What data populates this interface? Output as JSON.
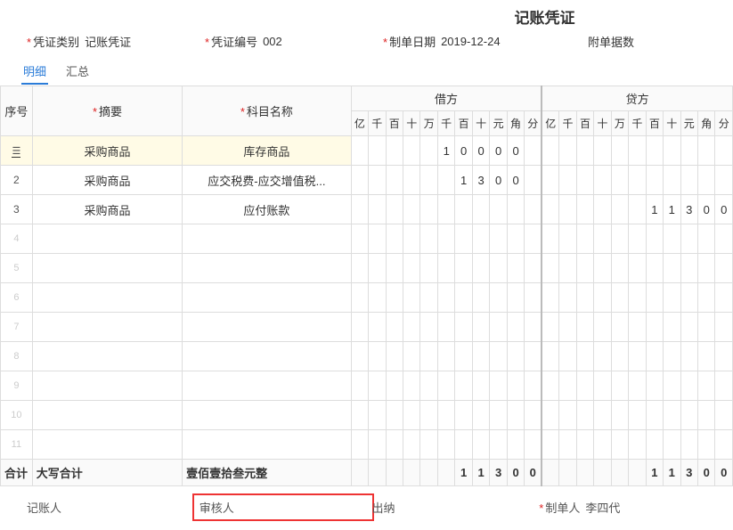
{
  "title": "记账凭证",
  "header": {
    "type_label": "凭证类别",
    "type_value": "记账凭证",
    "no_label": "凭证编号",
    "no_value": "002",
    "date_label": "制单日期",
    "date_value": "2019-12-24",
    "attach_label": "附单据数",
    "attach_value": ""
  },
  "tabs": {
    "detail": "明细",
    "summary": "汇总"
  },
  "columns": {
    "seq": "序号",
    "summary": "摘要",
    "account": "科目名称",
    "debit": "借方",
    "credit": "贷方",
    "digits": [
      "亿",
      "千",
      "百",
      "十",
      "万",
      "千",
      "百",
      "十",
      "元",
      "角",
      "分"
    ]
  },
  "rows": [
    {
      "seq": "",
      "summary": "采购商品",
      "account": "库存商品",
      "debit": [
        "",
        "",
        "",
        "",
        "",
        "1",
        "0",
        "0",
        "0",
        "0",
        ""
      ],
      "credit": [
        "",
        "",
        "",
        "",
        "",
        "",
        "",
        "",
        "",
        "",
        ""
      ]
    },
    {
      "seq": "2",
      "summary": "采购商品",
      "account": "应交税费-应交增值税...",
      "debit": [
        "",
        "",
        "",
        "",
        "",
        "",
        "1",
        "3",
        "0",
        "0",
        ""
      ],
      "credit": [
        "",
        "",
        "",
        "",
        "",
        "",
        "",
        "",
        "",
        "",
        ""
      ]
    },
    {
      "seq": "3",
      "summary": "采购商品",
      "account": "应付账款",
      "debit": [
        "",
        "",
        "",
        "",
        "",
        "",
        "",
        "",
        "",
        "",
        ""
      ],
      "credit": [
        "",
        "",
        "",
        "",
        "",
        "",
        "1",
        "1",
        "3",
        "0",
        "0"
      ]
    }
  ],
  "empty_rows": [
    "4",
    "5",
    "6",
    "7",
    "8",
    "9",
    "10",
    "11"
  ],
  "total": {
    "label": "合计",
    "cn_label": "大写合计",
    "cn_value": "壹佰壹拾叁元整",
    "debit": [
      "",
      "",
      "",
      "",
      "",
      "",
      "1",
      "1",
      "3",
      "0",
      "0"
    ],
    "credit": [
      "",
      "",
      "",
      "",
      "",
      "",
      "1",
      "1",
      "3",
      "0",
      "0"
    ]
  },
  "footer": {
    "book_label": "记账人",
    "book_value": "",
    "audit_label": "审核人",
    "audit_value": "",
    "cashier_label": "出纳",
    "cashier_value": "",
    "maker_label": "制单人",
    "maker_value": "李四代"
  }
}
